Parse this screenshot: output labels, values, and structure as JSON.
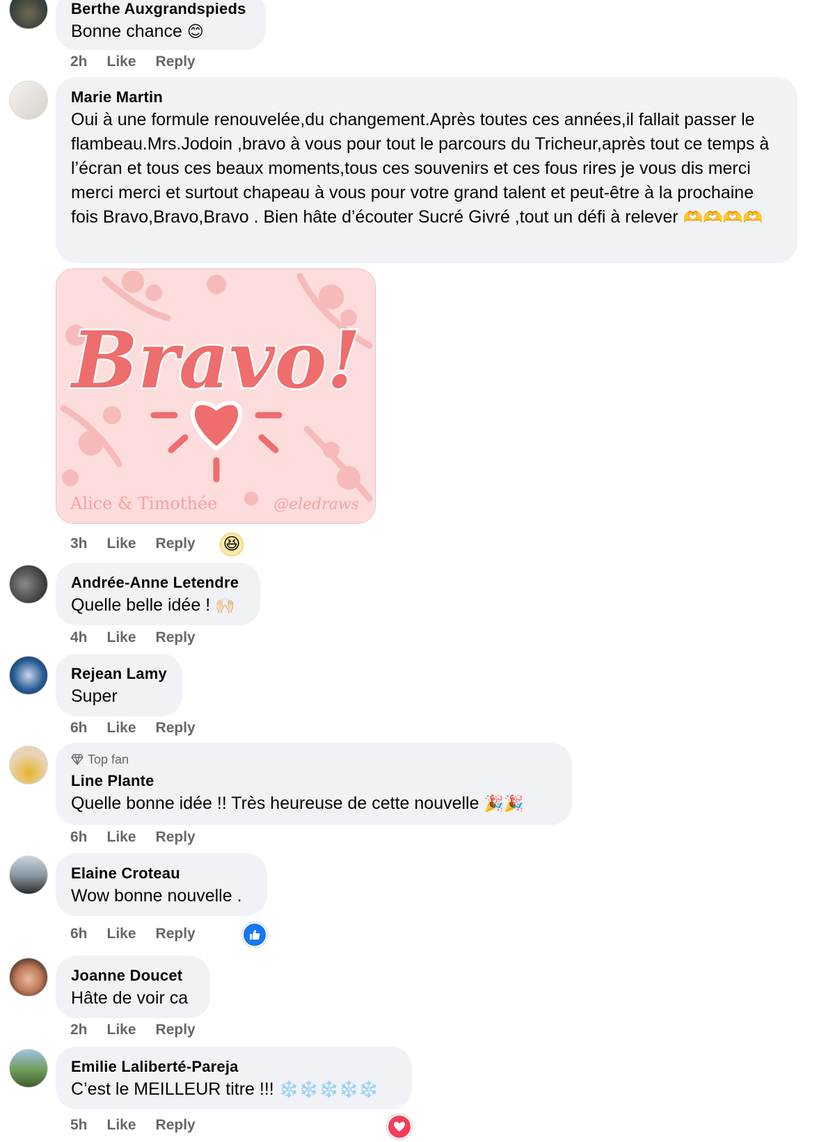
{
  "comments": [
    {
      "author": "Berthe Auxgrandspieds",
      "text": "Bonne chance",
      "emoji": "😊",
      "time": "2h",
      "like": "Like",
      "reply": "Reply"
    },
    {
      "author": "Marie Martin",
      "text": "Oui à une formule renouvelée,du changement.Après toutes ces années,il fallait passer le flambeau.Mrs.Jodoin ,bravo à vous pour tout le parcours du Tricheur,après tout ce temps à l’écran et tous ces beaux moments,tous ces souvenirs et ces fous rires je vous dis merci merci merci et surtout chapeau à vous pour votre grand talent et peut-être à la prochaine fois Bravo,Bravo,Bravo . Bien hâte d’écouter Sucré Givré ,tout un défi à relever",
      "emoji": "🫶🫶🫶🫶",
      "time": "3h",
      "like": "Like",
      "reply": "Reply",
      "reaction": "😆",
      "sticker": {
        "word": "Bravo!",
        "credit_left": "Alice & Timothée",
        "credit_right": "@eledraws"
      }
    },
    {
      "author": "Andrée-Anne Letendre",
      "text": "Quelle belle idée !",
      "emoji": "🙌🏻",
      "time": "4h",
      "like": "Like",
      "reply": "Reply"
    },
    {
      "author": "Rejean Lamy",
      "text": "Super",
      "time": "6h",
      "like": "Like",
      "reply": "Reply"
    },
    {
      "author": "Line Plante",
      "badge": "Top fan",
      "text": "Quelle bonne idée !! Très heureuse de cette nouvelle",
      "emoji": "🎉🎉",
      "time": "6h",
      "like": "Like",
      "reply": "Reply"
    },
    {
      "author": "Elaine Croteau",
      "text": "Wow bonne nouvelle .",
      "time": "6h",
      "like": "Like",
      "reply": "Reply",
      "reaction": "like"
    },
    {
      "author": "Joanne Doucet",
      "text": "Hâte de voir ca",
      "time": "2h",
      "like": "Like",
      "reply": "Reply"
    },
    {
      "author": "Emilie Laliberté-Pareja",
      "text": "C’est le MEILLEUR titre !!!",
      "emoji": "❄️❄️❄️❄️❄️",
      "time": "5h",
      "like": "Like",
      "reply": "Reply",
      "reaction": "love"
    }
  ],
  "colors": {
    "bubble": "#f0f2f5",
    "meta": "#65676b",
    "like_blue": "#1877f2",
    "love_red": "#f33e58"
  }
}
